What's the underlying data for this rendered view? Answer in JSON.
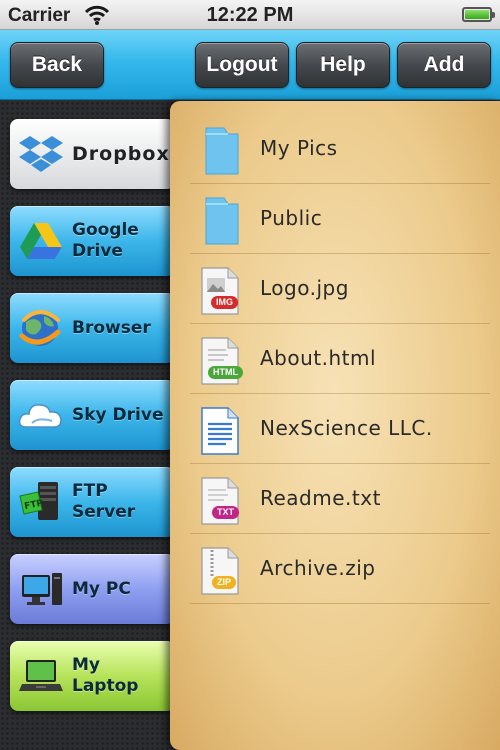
{
  "status": {
    "carrier": "Carrier",
    "time": "12:22 PM"
  },
  "nav": {
    "back": "Back",
    "logout": "Logout",
    "help": "Help",
    "add": "Add"
  },
  "services": [
    {
      "label": "Dropbox",
      "icon": "dropbox-icon"
    },
    {
      "label": "Google Drive",
      "icon": "google-drive-icon"
    },
    {
      "label": "Browser",
      "icon": "globe-icon"
    },
    {
      "label": "Sky Drive",
      "icon": "cloud-icon"
    },
    {
      "label": "FTP Server",
      "icon": "ftp-server-icon"
    },
    {
      "label": "My PC",
      "icon": "desktop-pc-icon"
    },
    {
      "label": "My Laptop",
      "icon": "laptop-icon"
    }
  ],
  "files": [
    {
      "name": "My Pics",
      "type": "folder"
    },
    {
      "name": "Public",
      "type": "folder"
    },
    {
      "name": "Logo.jpg",
      "type": "image",
      "badge": "IMG"
    },
    {
      "name": "About.html",
      "type": "html",
      "badge": "HTML"
    },
    {
      "name": "NexScience LLC.",
      "type": "document"
    },
    {
      "name": "Readme.txt",
      "type": "text",
      "badge": "TXT"
    },
    {
      "name": "Archive.zip",
      "type": "zip",
      "badge": "ZIP"
    }
  ],
  "colors": {
    "nav_bar": "#35b8ec",
    "folder": "#7fcdf2",
    "img_badge": "#d62b2b",
    "html_badge": "#4aa83a",
    "txt_badge": "#c2248a",
    "zip_badge": "#f0b21e"
  }
}
